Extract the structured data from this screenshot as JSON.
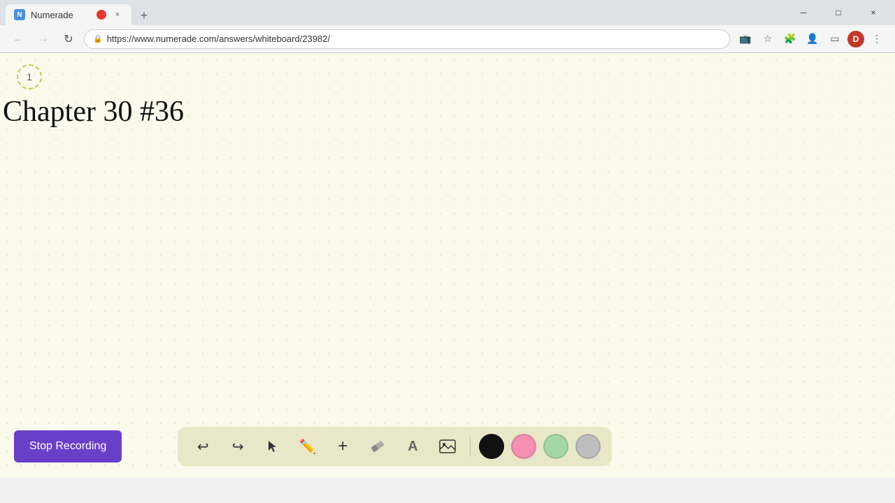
{
  "browser": {
    "tab": {
      "favicon_letter": "N",
      "title": "Numerade",
      "recording_active": true,
      "close_icon": "×"
    },
    "new_tab_icon": "+",
    "window_controls": {
      "minimize": "─",
      "maximize": "□",
      "close": "×"
    },
    "address_bar": {
      "url": "https://www.numerade.com/answers/whiteboard/23982/",
      "lock_icon": "🔒"
    },
    "nav": {
      "back": "←",
      "forward": "→",
      "reload": "↻"
    }
  },
  "whiteboard": {
    "page_number": "1",
    "title": "Chapter 30 #36"
  },
  "toolbar": {
    "stop_recording_label": "Stop Recording",
    "tools": [
      {
        "name": "undo",
        "icon": "↩",
        "label": "Undo"
      },
      {
        "name": "redo",
        "icon": "↪",
        "label": "Redo"
      },
      {
        "name": "select",
        "icon": "▲",
        "label": "Select"
      },
      {
        "name": "pencil",
        "icon": "✏",
        "label": "Pencil"
      },
      {
        "name": "add",
        "icon": "+",
        "label": "Add"
      },
      {
        "name": "eraser",
        "icon": "/",
        "label": "Eraser"
      },
      {
        "name": "text",
        "icon": "A",
        "label": "Text"
      },
      {
        "name": "image",
        "icon": "🖼",
        "label": "Image"
      }
    ],
    "colors": [
      {
        "name": "black",
        "value": "#111111"
      },
      {
        "name": "pink",
        "value": "#f48fb1"
      },
      {
        "name": "green",
        "value": "#a5d6a7"
      },
      {
        "name": "gray",
        "value": "#bdbdbd"
      }
    ]
  }
}
